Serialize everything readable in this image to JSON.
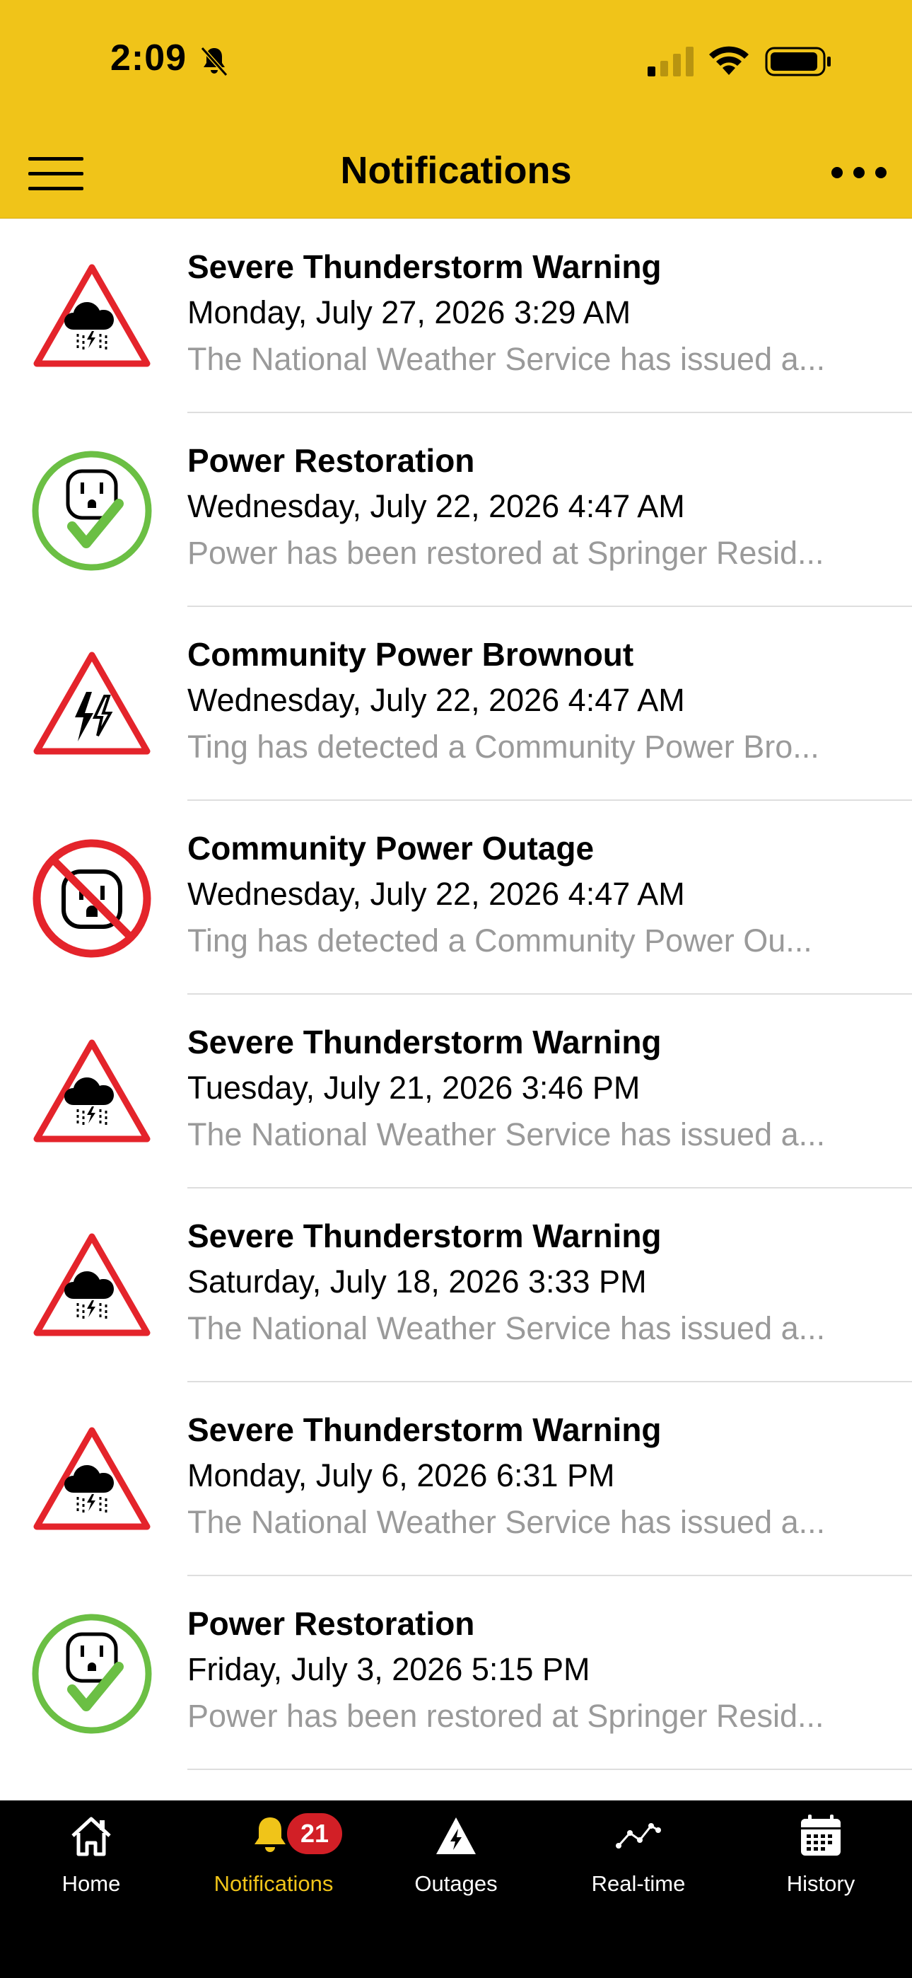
{
  "status_bar": {
    "time": "2:09"
  },
  "header": {
    "title": "Notifications"
  },
  "notifications": [
    {
      "type": "storm",
      "title": "Severe Thunderstorm Warning",
      "date": "Monday, July 27, 2026 3:29 AM",
      "preview": "The National Weather Service has issued a..."
    },
    {
      "type": "restored",
      "title": "Power Restoration",
      "date": "Wednesday, July 22, 2026 4:47 AM",
      "preview": "Power has been restored at Springer Resid..."
    },
    {
      "type": "brownout",
      "title": "Community Power Brownout",
      "date": "Wednesday, July 22, 2026 4:47 AM",
      "preview": "Ting has detected a Community Power Bro..."
    },
    {
      "type": "outage",
      "title": "Community Power Outage",
      "date": "Wednesday, July 22, 2026 4:47 AM",
      "preview": "Ting has detected a Community Power Ou..."
    },
    {
      "type": "storm",
      "title": "Severe Thunderstorm Warning",
      "date": "Tuesday, July 21, 2026 3:46 PM",
      "preview": "The National Weather Service has issued a..."
    },
    {
      "type": "storm",
      "title": "Severe Thunderstorm Warning",
      "date": "Saturday, July 18, 2026 3:33 PM",
      "preview": "The National Weather Service has issued a..."
    },
    {
      "type": "storm",
      "title": "Severe Thunderstorm Warning",
      "date": "Monday, July 6, 2026 6:31 PM",
      "preview": "The National Weather Service has issued a..."
    },
    {
      "type": "restored",
      "title": "Power Restoration",
      "date": "Friday, July 3, 2026 5:15 PM",
      "preview": "Power has been restored at Springer Resid..."
    }
  ],
  "tabbar": {
    "tabs": [
      {
        "label": "Home",
        "icon": "home-icon"
      },
      {
        "label": "Notifications",
        "icon": "bell-icon",
        "active": true,
        "badge": "21"
      },
      {
        "label": "Outages",
        "icon": "outage-warning-icon"
      },
      {
        "label": "Real-time",
        "icon": "trend-line-icon"
      },
      {
        "label": "History",
        "icon": "calendar-icon"
      }
    ]
  },
  "colors": {
    "accent": "#F0C419",
    "alert_red": "#E4242B",
    "ok_green": "#6BBF44",
    "badge_red": "#D21F26",
    "muted_text": "#9A9A9A"
  }
}
